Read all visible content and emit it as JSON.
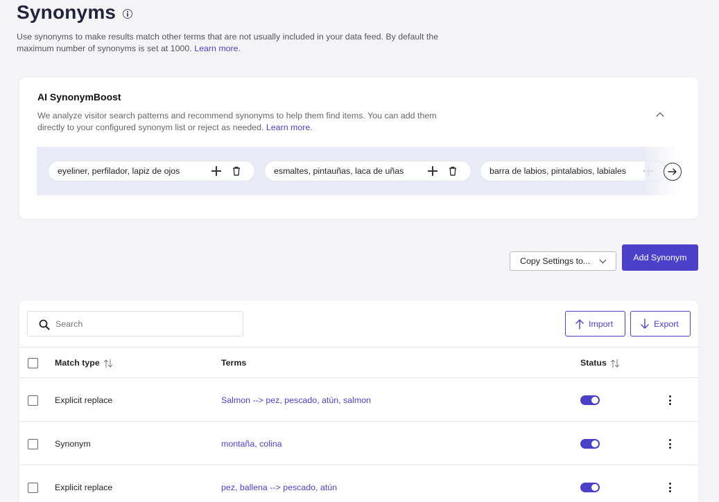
{
  "header": {
    "title": "Synonyms",
    "intro": "Use synonyms to make results match other terms that are not usually included in your data feed. By default the maximum number of synonyms is set at 1000. ",
    "intro_link": "Learn more."
  },
  "boost": {
    "title": "AI SynonymBoost",
    "description": "We analyze visitor search patterns and recommend synonyms to help them find items. You can add them directly to your configured synonym list or reject as needed. ",
    "description_link": "Learn more.",
    "suggestions": [
      {
        "text": "eyeliner, perfilador, lapiz de ojos"
      },
      {
        "text": "esmaltes, pintauñas, laca de uñas"
      },
      {
        "text": "barra de labios, pintalabios, labiales"
      }
    ]
  },
  "actions": {
    "copy_settings_label": "Copy Settings to...",
    "add_synonym_label": "Add Synonym"
  },
  "table": {
    "search_placeholder": "Search",
    "import_label": "Import",
    "export_label": "Export",
    "columns": {
      "match_type": "Match type",
      "terms": "Terms",
      "status": "Status"
    },
    "rows": [
      {
        "match_type": "Explicit replace",
        "terms": "Salmon --> pez, pescado, atún, salmon",
        "status": "on"
      },
      {
        "match_type": "Synonym",
        "terms": "montaña, colina",
        "status": "on"
      },
      {
        "match_type": "Explicit replace",
        "terms": "pez, ballena --> pescado, atún",
        "status": "on"
      }
    ]
  },
  "colors": {
    "accent": "#4a41c8",
    "title": "#23233d",
    "background": "#f5f5f7",
    "suggestion_strip": "#ebebf7"
  }
}
